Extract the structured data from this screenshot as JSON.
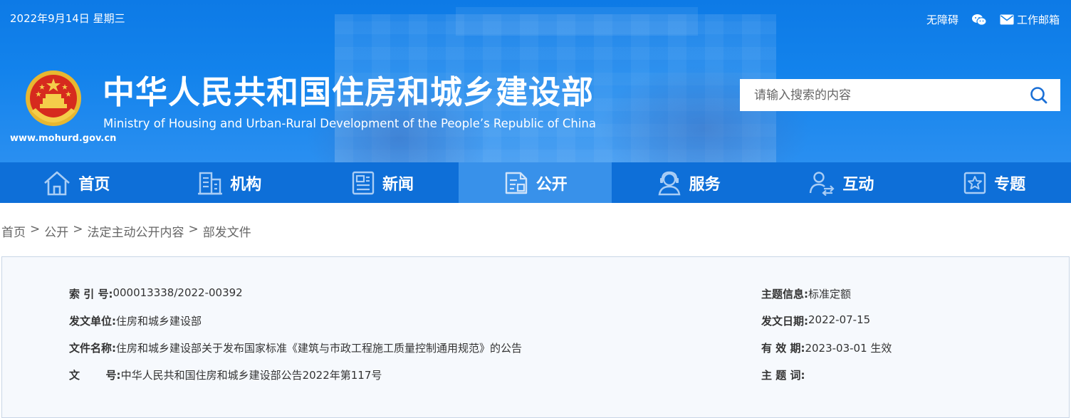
{
  "header": {
    "date": "2022年9月14日 星期三",
    "links": {
      "accessibility": "无障碍",
      "mail": "工作邮箱"
    },
    "site_url": "www.mohurd.gov.cn",
    "title": "中华人民共和国住房和城乡建设部",
    "subtitle": "Ministry of Housing and Urban-Rural Development of the People’s Republic of China",
    "icons": {
      "emblem": "national-emblem",
      "wechat": "wechat-icon",
      "mail": "mail-icon",
      "search": "search-icon"
    }
  },
  "search": {
    "placeholder": "请输入搜索的内容"
  },
  "nav": {
    "items": [
      {
        "label": "首页",
        "icon": "home-icon"
      },
      {
        "label": "机构",
        "icon": "building-icon"
      },
      {
        "label": "新闻",
        "icon": "news-icon"
      },
      {
        "label": "公开",
        "icon": "document-icon",
        "active": true
      },
      {
        "label": "服务",
        "icon": "service-icon"
      },
      {
        "label": "互动",
        "icon": "interaction-icon"
      },
      {
        "label": "专题",
        "icon": "star-icon"
      }
    ]
  },
  "breadcrumb": {
    "items": [
      "首页",
      "公开",
      "法定主动公开内容",
      "部发文件"
    ],
    "separator": ">"
  },
  "info": {
    "index_label": "索 引 号:",
    "index_value": "000013338/2022-00392",
    "topic_label": "主题信息:",
    "topic_value": "标准定额",
    "issuer_label": "发文单位:",
    "issuer_value": "住房和城乡建设部",
    "date_label": "发文日期:",
    "date_value": "2022-07-15",
    "name_label": "文件名称:",
    "name_value": "住房和城乡建设部关于发布国家标准《建筑与市政工程施工质量控制通用规范》的公告",
    "validity_label": "有 效 期:",
    "validity_value": "2023-03-01 生效",
    "number_label": "文       号:",
    "number_value": "中华人民共和国住房和城乡建设部公告2022年第117号",
    "keywords_label": "主 题 词:",
    "keywords_value": ""
  },
  "colors": {
    "header_blue": "#0d7ae6",
    "nav_blue": "#0e6fd8",
    "nav_active": "#3891ea",
    "panel_bg": "#f6f9fd"
  }
}
